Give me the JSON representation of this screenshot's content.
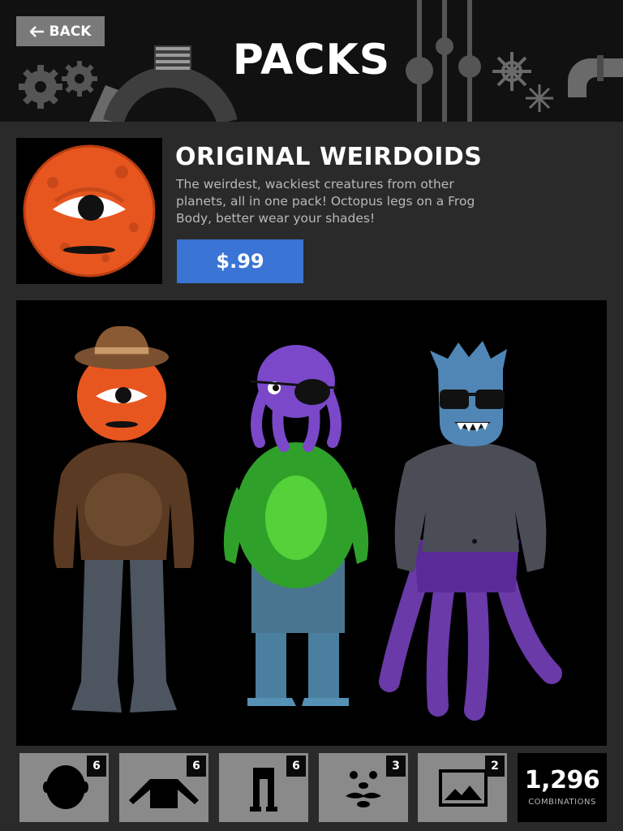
{
  "header": {
    "back_label": "BACK",
    "title": "PACKS"
  },
  "pack": {
    "name": "ORIGINAL WEIRDOIDS",
    "description": "The weirdest, wackiest creatures from other planets, all in one pack! Octopus legs on a Frog Body, better wear your shades!",
    "price": "$.99"
  },
  "showcase": {
    "characters": [
      {
        "head": "orange cyclops with cowboy hat",
        "body": "furry brown",
        "legs": "furry grey"
      },
      {
        "head": "purple octopus with eye patch",
        "body": "green frog",
        "legs": "blue boots"
      },
      {
        "head": "blue monster with sunglasses",
        "body": "grey muscular",
        "legs": "purple tentacles"
      }
    ]
  },
  "categories": [
    {
      "name": "heads",
      "icon": "head-icon",
      "count": "6"
    },
    {
      "name": "bodies",
      "icon": "shirt-icon",
      "count": "6"
    },
    {
      "name": "legs",
      "icon": "pants-icon",
      "count": "6"
    },
    {
      "name": "faces",
      "icon": "face-icon",
      "count": "3"
    },
    {
      "name": "backgrounds",
      "icon": "picture-icon",
      "count": "2"
    }
  ],
  "combinations": {
    "value": "1,296",
    "label": "COMBINATIONS"
  },
  "colors": {
    "header_bg": "#111111",
    "page_bg": "#2a2a2a",
    "price_button": "#3a74d4",
    "tile_bg": "#8a8a8a"
  }
}
